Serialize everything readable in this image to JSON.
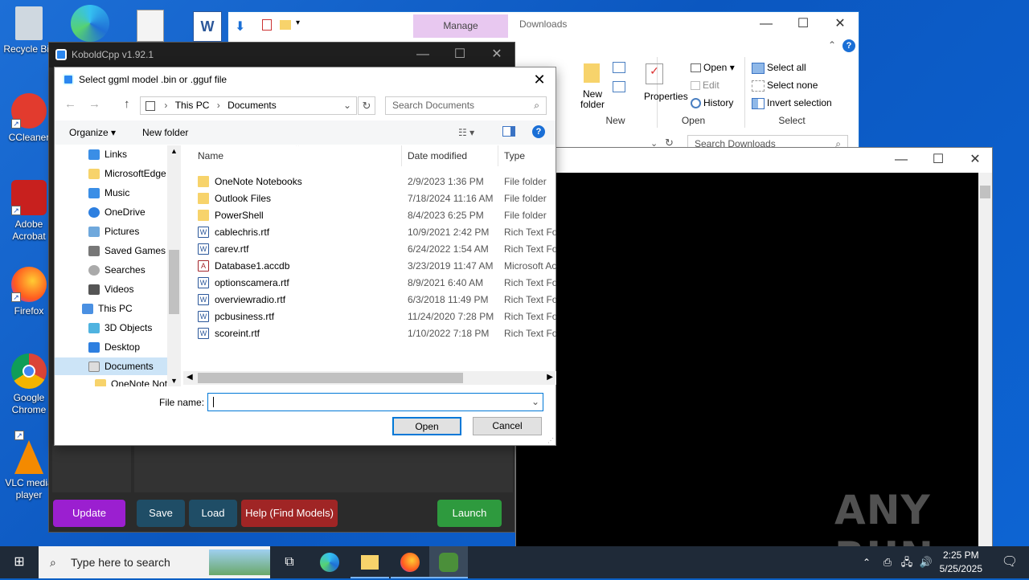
{
  "desktop": {
    "icons": [
      {
        "label": "Recycle Bin",
        "color": "#cfd8e0"
      },
      {
        "label": "CCleaner",
        "color": "#e23b2e"
      },
      {
        "label": "Adobe Acrobat",
        "color": "#c8201e"
      },
      {
        "label": "Firefox",
        "color": "#ff7a18"
      },
      {
        "label": "Google Chrome",
        "color": "#2a8a3e"
      },
      {
        "label": "VLC media player",
        "color": "#f48a00"
      }
    ]
  },
  "explorer": {
    "manage_tab": "Manage",
    "title": "Downloads",
    "ribbon": {
      "new_folder": "New folder",
      "new_group": "New",
      "properties": "Properties",
      "open": "Open",
      "edit": "Edit",
      "history": "History",
      "open_group": "Open",
      "select_all": "Select all",
      "select_none": "Select none",
      "invert_selection": "Invert selection",
      "select_group": "Select"
    },
    "search_placeholder": "Search Downloads"
  },
  "kobold": {
    "title": "KoboldCpp v1.92.1",
    "buttons": {
      "update": "Update",
      "save": "Save",
      "load": "Load",
      "help": "Help (Find Models)",
      "launch": "Launch"
    }
  },
  "dialog": {
    "title": "Select ggml model .bin or .gguf file",
    "breadcrumb": [
      "This PC",
      "Documents"
    ],
    "search_placeholder": "Search Documents",
    "organize": "Organize",
    "new_folder": "New folder",
    "nav_items": [
      {
        "label": "Links"
      },
      {
        "label": "MicrosoftEdge"
      },
      {
        "label": "Music"
      },
      {
        "label": "OneDrive"
      },
      {
        "label": "Pictures"
      },
      {
        "label": "Saved Games"
      },
      {
        "label": "Searches"
      },
      {
        "label": "Videos"
      },
      {
        "label": "This PC"
      },
      {
        "label": "3D Objects"
      },
      {
        "label": "Desktop"
      },
      {
        "label": "Documents"
      },
      {
        "label": "OneNote Not"
      }
    ],
    "columns": {
      "name": "Name",
      "date": "Date modified",
      "type": "Type"
    },
    "files": [
      {
        "name": "OneNote Notebooks",
        "date": "2/9/2023 1:36 PM",
        "type": "File folder",
        "kind": "folder"
      },
      {
        "name": "Outlook Files",
        "date": "7/18/2024 11:16 AM",
        "type": "File folder",
        "kind": "folder"
      },
      {
        "name": "PowerShell",
        "date": "8/4/2023 6:25 PM",
        "type": "File folder",
        "kind": "folder"
      },
      {
        "name": "cablechris.rtf",
        "date": "10/9/2021 2:42 PM",
        "type": "Rich Text Format",
        "kind": "rtf"
      },
      {
        "name": "carev.rtf",
        "date": "6/24/2022 1:54 AM",
        "type": "Rich Text Format",
        "kind": "rtf"
      },
      {
        "name": "Database1.accdb",
        "date": "3/23/2019 11:47 AM",
        "type": "Microsoft Access",
        "kind": "access"
      },
      {
        "name": "optionscamera.rtf",
        "date": "8/9/2021 6:40 AM",
        "type": "Rich Text Format",
        "kind": "rtf"
      },
      {
        "name": "overviewradio.rtf",
        "date": "6/3/2018 11:49 PM",
        "type": "Rich Text Format",
        "kind": "rtf"
      },
      {
        "name": "pcbusiness.rtf",
        "date": "11/24/2020 7:28 PM",
        "type": "Rich Text Format",
        "kind": "rtf"
      },
      {
        "name": "scoreint.rtf",
        "date": "1/10/2022 7:18 PM",
        "type": "Rich Text Format",
        "kind": "rtf"
      }
    ],
    "file_name_label": "File name:",
    "file_name_value": "",
    "open_button": "Open",
    "cancel_button": "Cancel"
  },
  "watermark": "ANY RUN",
  "taskbar": {
    "search_placeholder": "Type here to search",
    "time": "2:25 PM",
    "date": "5/25/2025"
  }
}
